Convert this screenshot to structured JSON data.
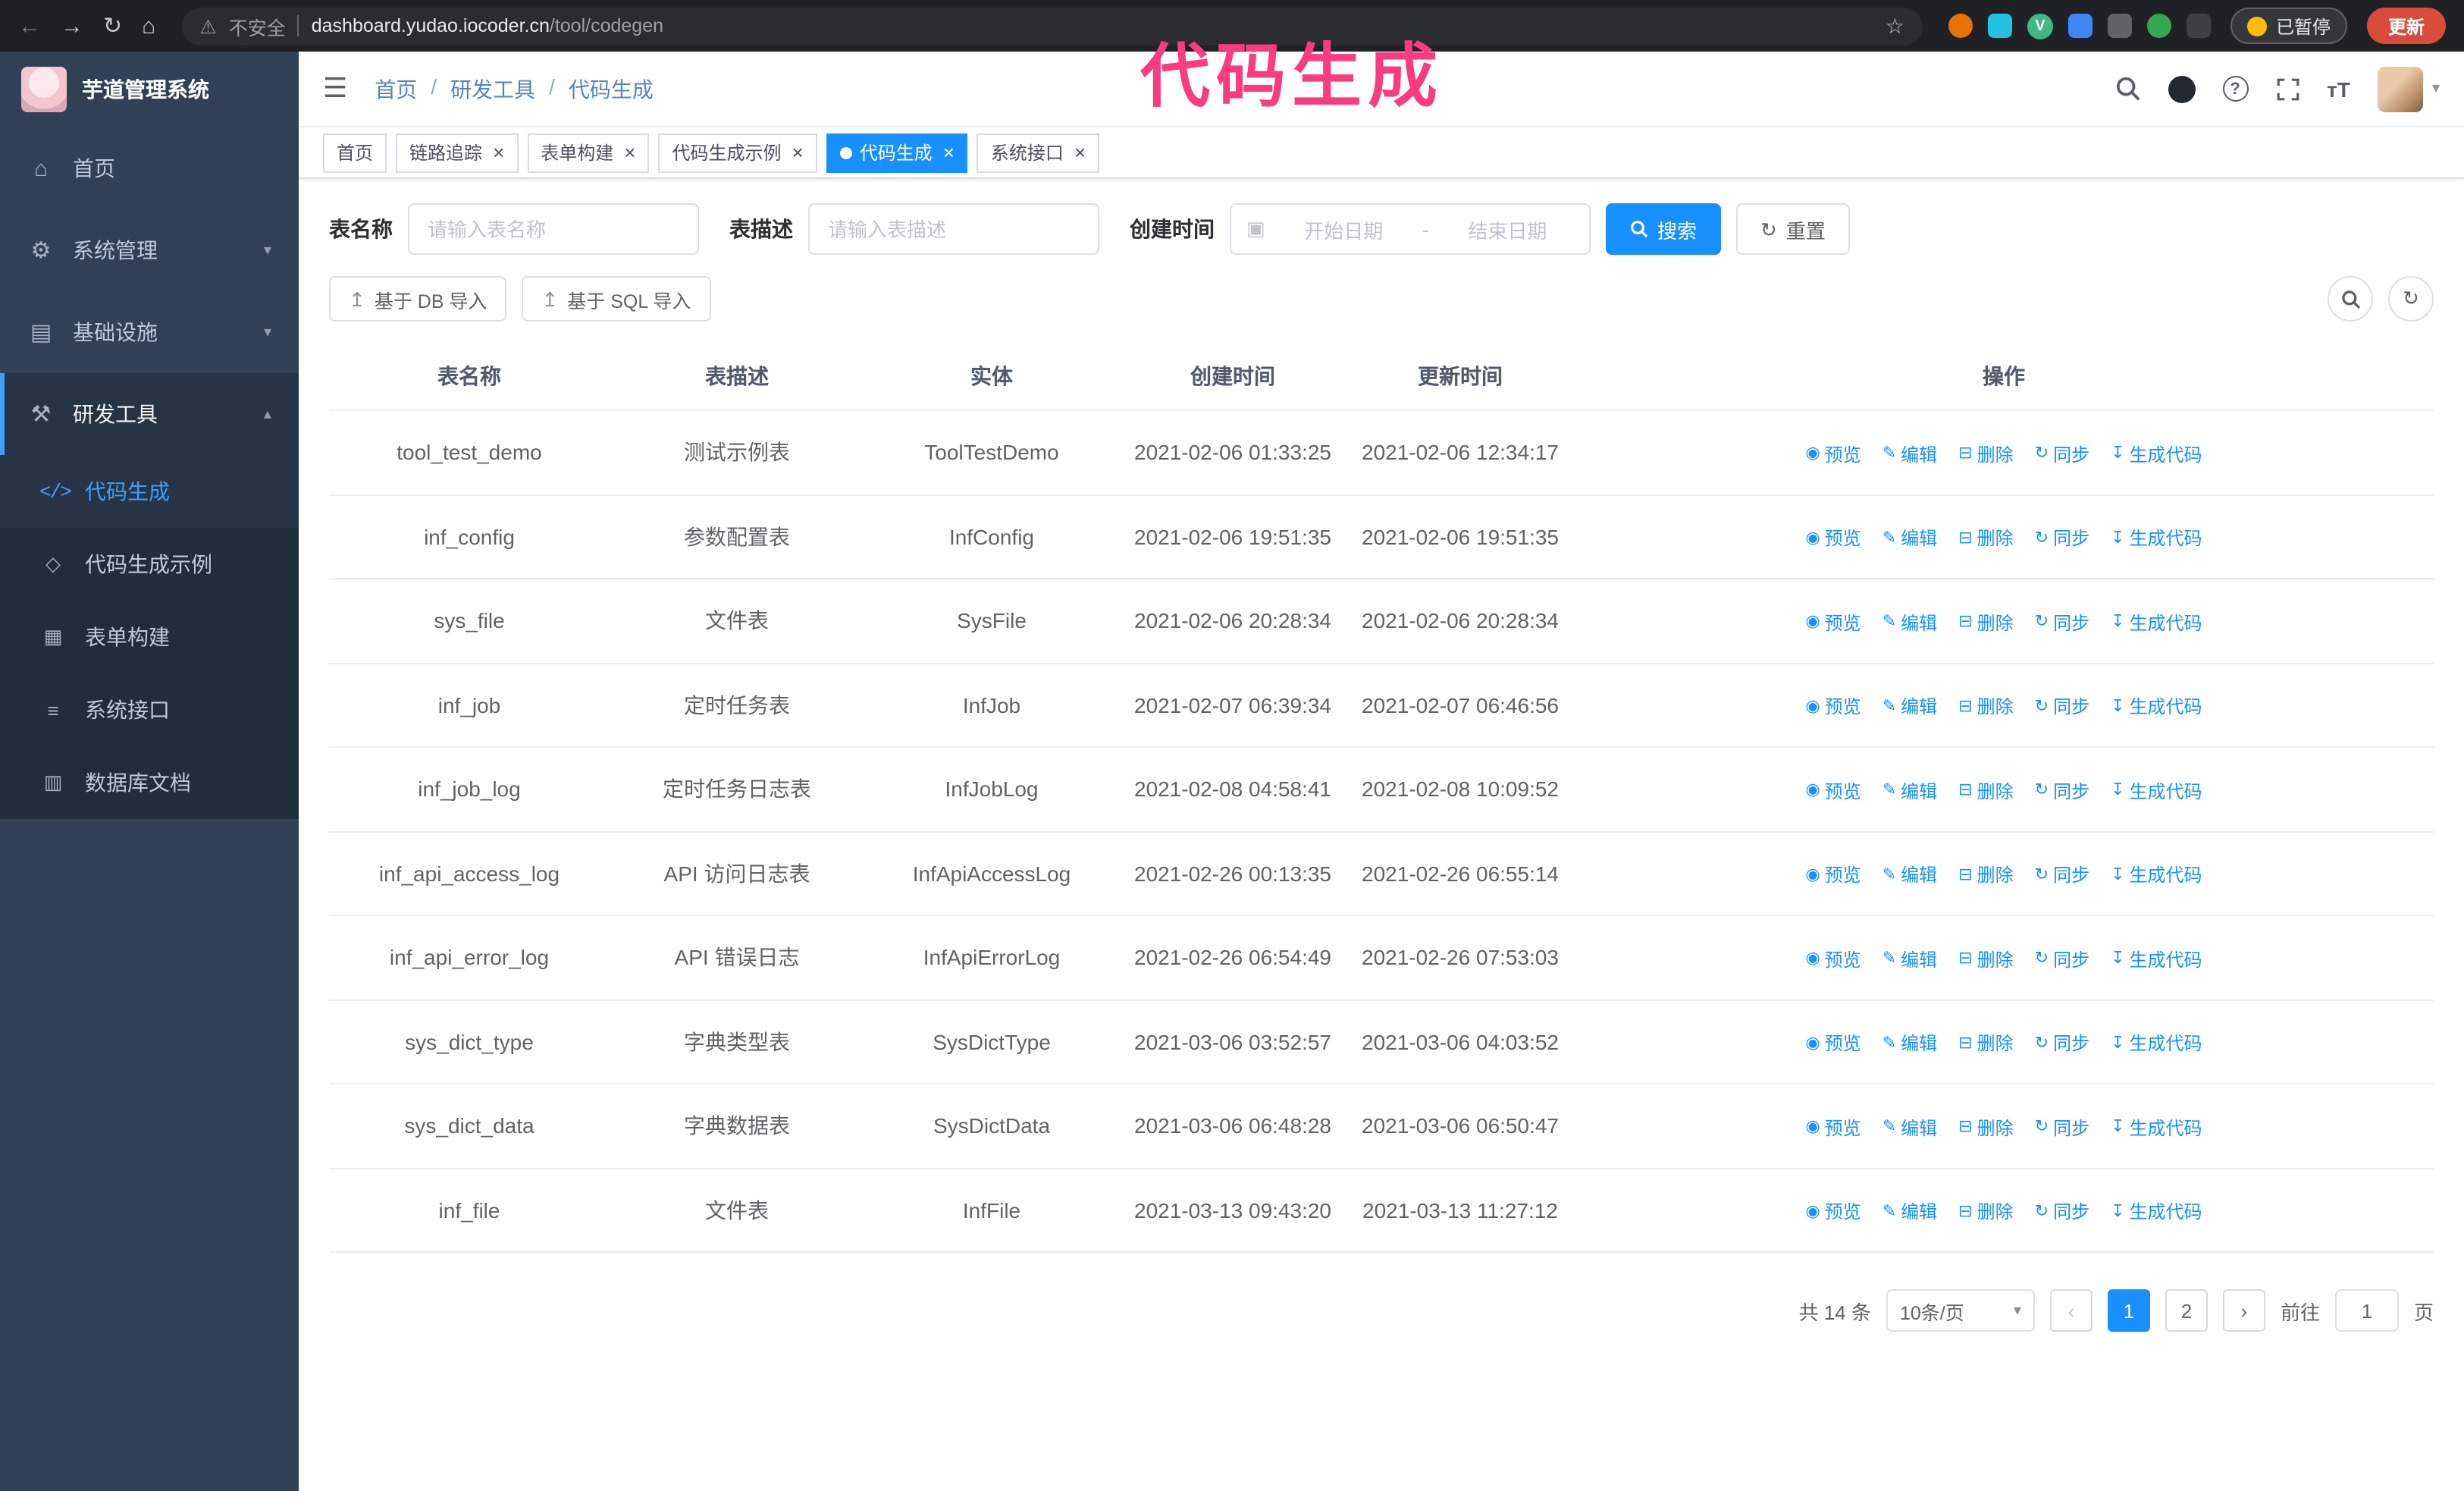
{
  "browser": {
    "warning_text": "不安全",
    "url_host": "dashboard.yudao.iocoder.cn",
    "url_path": "/tool/codegen",
    "paused_badge": "已暂停",
    "update_button": "更新"
  },
  "annotation": {
    "text": "代码生成"
  },
  "icons": {
    "back": "←",
    "forward": "→",
    "reload": "↻",
    "home": "⌂",
    "warning": "⚠",
    "star": "☆",
    "vue_badge": "V",
    "hamburger": "☰",
    "chevron_down": "▾",
    "chevron_up": "▴",
    "menu_home": "⌂",
    "menu_system": "⚙",
    "menu_infra": "▤",
    "menu_tools": "⚒",
    "sub_codegen": "</>",
    "sub_example": "◇",
    "sub_form": "▦",
    "sub_api": "≡",
    "sub_dbdoc": "▥",
    "help": "?",
    "font_size": "тT",
    "caret_down": "▾",
    "calendar": "▣",
    "upload": "↥",
    "refresh": "↻",
    "close": "×",
    "prev": "‹",
    "next": "›"
  },
  "sidebar": {
    "logo_title": "芋道管理系统",
    "items": [
      {
        "label": "首页"
      },
      {
        "label": "系统管理"
      },
      {
        "label": "基础设施"
      },
      {
        "label": "研发工具"
      }
    ],
    "submenu": [
      {
        "label": "代码生成"
      },
      {
        "label": "代码生成示例"
      },
      {
        "label": "表单构建"
      },
      {
        "label": "系统接口"
      },
      {
        "label": "数据库文档"
      }
    ]
  },
  "breadcrumb": {
    "separator": "/",
    "items": [
      "首页",
      "研发工具",
      "代码生成"
    ]
  },
  "tabs": [
    {
      "label": "首页"
    },
    {
      "label": "链路追踪"
    },
    {
      "label": "表单构建"
    },
    {
      "label": "代码生成示例"
    },
    {
      "label": "代码生成"
    },
    {
      "label": "系统接口"
    }
  ],
  "filters": {
    "table_name_label": "表名称",
    "table_name_placeholder": "请输入表名称",
    "table_desc_label": "表描述",
    "table_desc_placeholder": "请输入表描述",
    "create_time_label": "创建时间",
    "date_start_placeholder": "开始日期",
    "date_separator": "-",
    "date_end_placeholder": "结束日期",
    "search_button": "搜索",
    "reset_button": "重置"
  },
  "toolbar": {
    "import_db_label": "基于 DB 导入",
    "import_sql_label": "基于 SQL 导入"
  },
  "table": {
    "columns": [
      "表名称",
      "表描述",
      "实体",
      "创建时间",
      "更新时间",
      "操作"
    ],
    "actions": [
      {
        "icon": "◉",
        "label": "预览"
      },
      {
        "icon": "✎",
        "label": "编辑"
      },
      {
        "icon": "⊟",
        "label": "删除"
      },
      {
        "icon": "↻",
        "label": "同步"
      },
      {
        "icon": "↧",
        "label": "生成代码"
      }
    ],
    "rows": [
      {
        "name": "tool_test_demo",
        "desc": "测试示例表",
        "entity": "ToolTestDemo",
        "created": "2021-02-06 01:33:25",
        "updated": "2021-02-06 12:34:17"
      },
      {
        "name": "inf_config",
        "desc": "参数配置表",
        "entity": "InfConfig",
        "created": "2021-02-06 19:51:35",
        "updated": "2021-02-06 19:51:35"
      },
      {
        "name": "sys_file",
        "desc": "文件表",
        "entity": "SysFile",
        "created": "2021-02-06 20:28:34",
        "updated": "2021-02-06 20:28:34"
      },
      {
        "name": "inf_job",
        "desc": "定时任务表",
        "entity": "InfJob",
        "created": "2021-02-07 06:39:34",
        "updated": "2021-02-07 06:46:56"
      },
      {
        "name": "inf_job_log",
        "desc": "定时任务日志表",
        "entity": "InfJobLog",
        "created": "2021-02-08 04:58:41",
        "updated": "2021-02-08 10:09:52"
      },
      {
        "name": "inf_api_access_log",
        "desc": "API 访问日志表",
        "entity": "InfApiAccessLog",
        "created": "2021-02-26 00:13:35",
        "updated": "2021-02-26 06:55:14"
      },
      {
        "name": "inf_api_error_log",
        "desc": "API 错误日志",
        "entity": "InfApiErrorLog",
        "created": "2021-02-26 06:54:49",
        "updated": "2021-02-26 07:53:03"
      },
      {
        "name": "sys_dict_type",
        "desc": "字典类型表",
        "entity": "SysDictType",
        "created": "2021-03-06 03:52:57",
        "updated": "2021-03-06 04:03:52"
      },
      {
        "name": "sys_dict_data",
        "desc": "字典数据表",
        "entity": "SysDictData",
        "created": "2021-03-06 06:48:28",
        "updated": "2021-03-06 06:50:47"
      },
      {
        "name": "inf_file",
        "desc": "文件表",
        "entity": "InfFile",
        "created": "2021-03-13 09:43:20",
        "updated": "2021-03-13 11:27:12"
      }
    ]
  },
  "pagination": {
    "total_label": "共 14 条",
    "page_size_label": "10条/页",
    "page_1": "1",
    "page_2": "2",
    "goto_label": "前往",
    "goto_value": "1",
    "goto_unit": "页"
  },
  "colors": {
    "primary": "#1890ff",
    "sidebar_bg": "#304156",
    "submenu_bg": "#1f2d3d",
    "active_menu_text": "#409eff",
    "annotation_pink": "#f93b80",
    "update_button_red": "#d94c3b",
    "browser_bar_bg": "#202124"
  }
}
